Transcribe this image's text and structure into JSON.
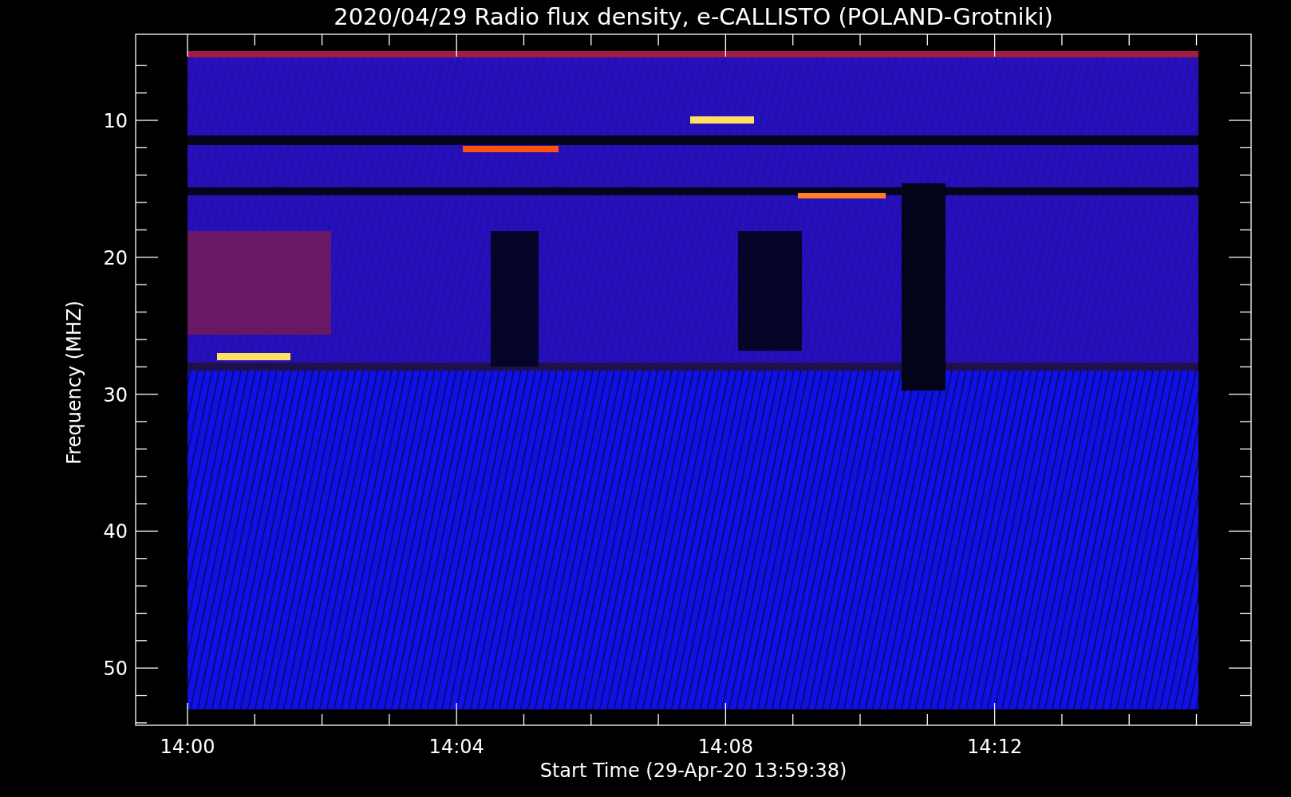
{
  "title": "2020/04/29  Radio flux density, e-CALLISTO (POLAND-Grotniki)",
  "y_axis": {
    "label": "Frequency (MHZ)",
    "ticks": [
      "10",
      "20",
      "30",
      "40",
      "50"
    ]
  },
  "x_axis": {
    "label": "Start Time (29-Apr-20 13:59:38)",
    "ticks": [
      "14:00",
      "14:04",
      "14:08",
      "14:12"
    ]
  }
}
